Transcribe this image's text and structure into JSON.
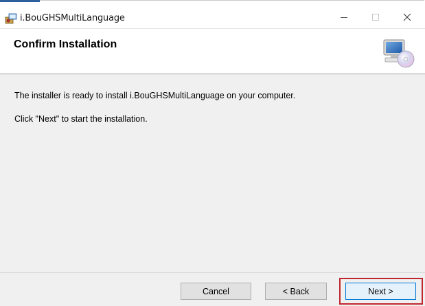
{
  "window": {
    "title": "i.BouGHSMultiLanguage",
    "controls": {
      "minimize_icon": "minimize-icon",
      "maximize_icon": "maximize-icon",
      "close_icon": "close-icon"
    }
  },
  "header": {
    "title": "Confirm Installation",
    "icon": "computer-cd-icon"
  },
  "content": {
    "line1": "The installer is ready to install i.BouGHSMultiLanguage on your computer.",
    "line2": "Click \"Next\" to start the installation."
  },
  "footer": {
    "cancel_label": "Cancel",
    "back_label": "< Back",
    "next_label": "Next >"
  },
  "colors": {
    "highlight": "#c0272d",
    "title_accent": "#2b5f9e",
    "default_button_border": "#0078d7"
  }
}
